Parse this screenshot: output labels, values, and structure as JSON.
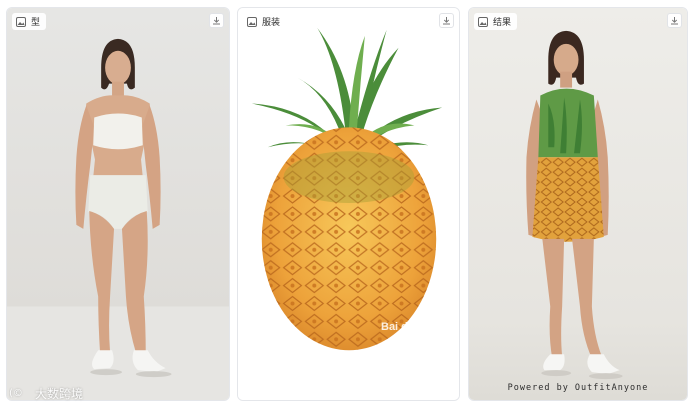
{
  "cards": {
    "model": {
      "label": "型"
    },
    "garment": {
      "label": "服装"
    },
    "result": {
      "label": "结果",
      "powered_by": "Powered by OutfitAnyone"
    }
  },
  "watermarks": {
    "garment_image": "Bai du 經驗",
    "footer": "大数跨境"
  },
  "icons": {
    "tag": "image-icon",
    "action": "download-icon"
  }
}
